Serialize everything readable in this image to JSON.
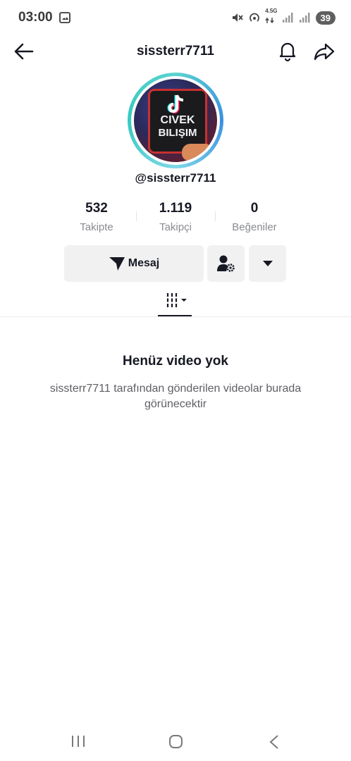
{
  "status_bar": {
    "time": "03:00",
    "network": "4.5G",
    "battery": "39"
  },
  "header": {
    "title": "sissterr7711",
    "icons": [
      "back-arrow-icon",
      "bell-icon",
      "share-icon"
    ]
  },
  "profile": {
    "avatar_text_line1": "CIVEK",
    "avatar_text_line2": "BILIŞIM",
    "handle": "@sissterr7711",
    "stats": [
      {
        "value": "532",
        "label": "Takipte"
      },
      {
        "value": "1.119",
        "label": "Takipçi"
      },
      {
        "value": "0",
        "label": "Beğeniler"
      }
    ]
  },
  "actions": {
    "message_label": "Mesaj",
    "icons": [
      "send-icon",
      "user-settings-icon",
      "caret-down-icon"
    ]
  },
  "tabs": {
    "icons": [
      "video-grid-icon"
    ]
  },
  "empty_state": {
    "title": "Henüz video yok",
    "description": "sissterr7711 tarafından gönderilen videolar burada görünecektir"
  },
  "colors": {
    "text": "#161823",
    "muted": "#8a8b91",
    "button_bg": "#f1f1f2",
    "ring": "#5ad3d0"
  }
}
